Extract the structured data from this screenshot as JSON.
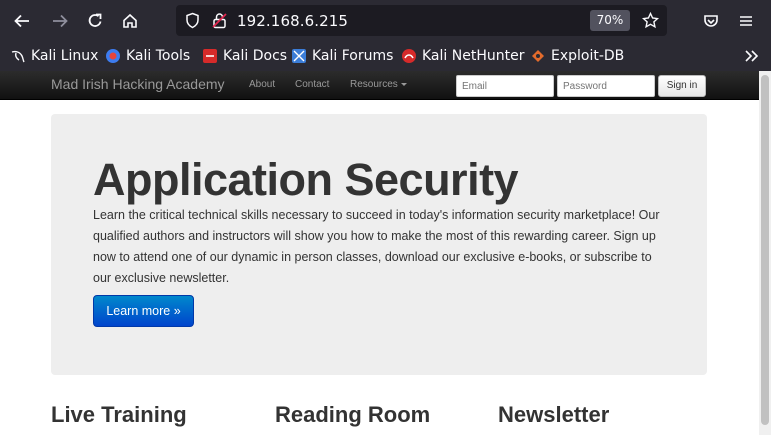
{
  "browser": {
    "url": "192.168.6.215",
    "zoom": "70%",
    "bookmarks": [
      "Kali Linux",
      "Kali Tools",
      "Kali Docs",
      "Kali Forums",
      "Kali NetHunter",
      "Exploit-DB"
    ]
  },
  "site": {
    "brand": "Mad Irish Hacking Academy",
    "nav": {
      "about": "About",
      "contact": "Contact",
      "resources": "Resources"
    },
    "login": {
      "email_placeholder": "Email",
      "password_placeholder": "Password",
      "signin": "Sign in"
    }
  },
  "hero": {
    "title": "Application Security",
    "text": "Learn the critical technical skills necessary to succeed in today's information security marketplace! Our qualified authors and instructors will show you how to make the most of this rewarding career. Sign up now to attend one of our dynamic in person classes, download our exclusive e-books, or subscribe to our exclusive newsletter.",
    "button": "Learn more »"
  },
  "columns": [
    "Live Training",
    "Reading Room",
    "Newsletter"
  ]
}
